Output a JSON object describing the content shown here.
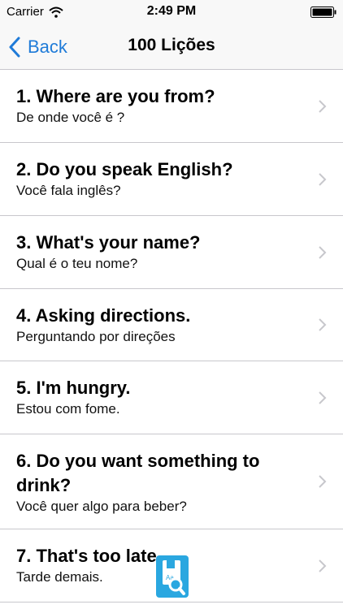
{
  "status_bar": {
    "carrier": "Carrier",
    "time": "2:49 PM"
  },
  "nav": {
    "back_label": "Back",
    "title": "100 Lições"
  },
  "lessons": [
    {
      "title": "1. Where are you from?",
      "subtitle": "De onde você é ?"
    },
    {
      "title": "2. Do you speak English?",
      "subtitle": "Você fala inglês?"
    },
    {
      "title": "3. What's your name?",
      "subtitle": "Qual é o teu nome?"
    },
    {
      "title": "4. Asking directions.",
      "subtitle": "Perguntando por direções"
    },
    {
      "title": "5. I'm hungry.",
      "subtitle": "Estou com fome."
    },
    {
      "title": "6. Do you want something to drink?",
      "subtitle": "Você quer algo para beber?"
    },
    {
      "title": "7. That's too late.",
      "subtitle": "Tarde demais."
    }
  ],
  "fab": {
    "icon": "dictionary-search-icon",
    "label": "Aa"
  },
  "colors": {
    "accent": "#1f7bd8",
    "fab": "#2aa7e0",
    "separator": "#c8c7cc",
    "chevron": "#c7c7cc"
  }
}
